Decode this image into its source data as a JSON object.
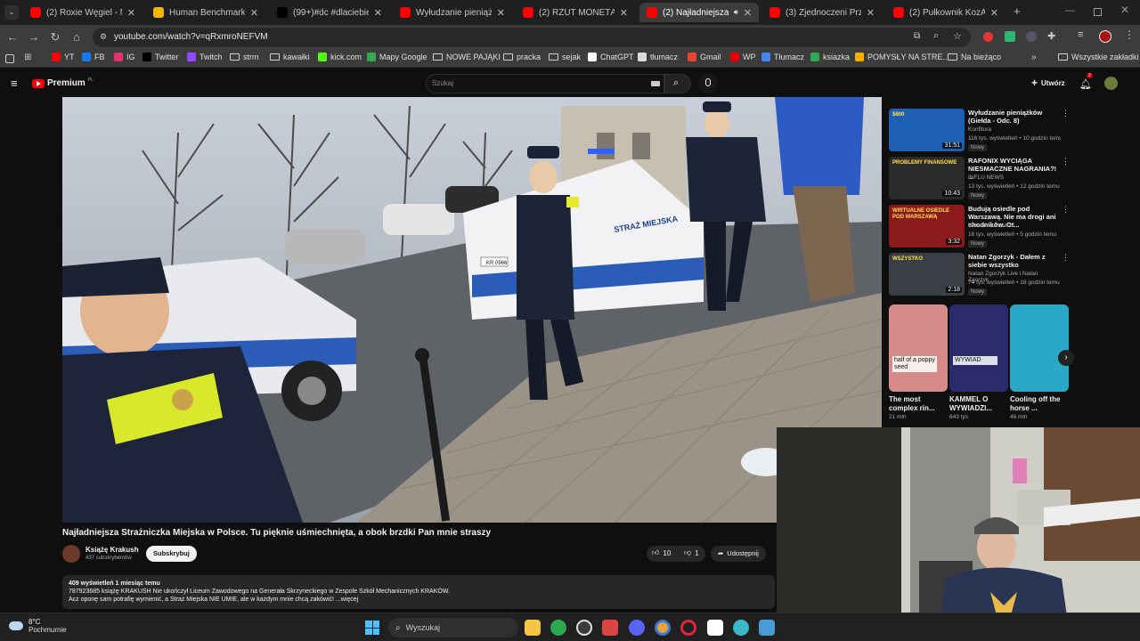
{
  "tabs": [
    {
      "title": "(2) Roxie Węgiel - Miasto",
      "color": "#ff0000"
    },
    {
      "title": "Human Benchmark - Rea",
      "color": "#f5b400"
    },
    {
      "title": "(99+)#dc #dlaciebie #tikt",
      "color": "#000000"
    },
    {
      "title": "Wyłudzanie pieniążków (",
      "color": "#ff0000"
    },
    {
      "title": "(2) RZUT MONETĄ DECYD",
      "color": "#ff0000"
    },
    {
      "title": "(2) Najładniejsza Straż",
      "color": "#ff0000"
    },
    {
      "title": "(3) Zjednoczeni Przeciw R",
      "color": "#ff0000"
    },
    {
      "title": "(2) Pułkownik KozAK z ofi",
      "color": "#ff0000"
    }
  ],
  "address": {
    "url": "youtube.com/watch?v=qRxmroNEFVM"
  },
  "bookmarks": [
    {
      "label": "YT",
      "icon": "youtube-icon",
      "color": "#ff0000"
    },
    {
      "label": "FB",
      "icon": "facebook-icon",
      "color": "#1877f2"
    },
    {
      "label": "IG",
      "icon": "instagram-icon",
      "color": "#e1306c"
    },
    {
      "label": "Twitter",
      "icon": "x-icon",
      "color": "#000000"
    },
    {
      "label": "Twitch",
      "icon": "twitch-icon",
      "color": "#9146ff"
    },
    {
      "label": "strm",
      "icon": "folder-icon"
    },
    {
      "label": "kawałki",
      "icon": "folder-icon"
    },
    {
      "label": "kick.com",
      "icon": "kick-icon",
      "color": "#53fc18"
    },
    {
      "label": "Mapy Google",
      "icon": "map-pin-icon",
      "color": "#34a853"
    },
    {
      "label": "NOWE PAJĄKI",
      "icon": "folder-icon"
    },
    {
      "label": "pracka",
      "icon": "folder-icon"
    },
    {
      "label": "sejak",
      "icon": "folder-icon"
    },
    {
      "label": "ChatGPT",
      "icon": "chatgpt-icon",
      "color": "#ffffff"
    },
    {
      "label": "tłumacz",
      "icon": "translate-icon",
      "color": "#dddddd"
    },
    {
      "label": "Gmail",
      "icon": "gmail-icon",
      "color": "#ea4335"
    },
    {
      "label": "WP",
      "icon": "wp-icon",
      "color": "#e60000"
    },
    {
      "label": "Tłumacz",
      "icon": "google-translate-icon",
      "color": "#4285f4"
    },
    {
      "label": "ksiazka",
      "icon": "grid-icon",
      "color": "#34a853"
    },
    {
      "label": "POMYSŁY NA STRE...",
      "icon": "keep-icon",
      "color": "#f9ab00"
    },
    {
      "label": "Na bieżąco",
      "icon": "folder-icon"
    }
  ],
  "bookmarks_other": "Wszystkie zakładki",
  "yt": {
    "logo_label": "Premium",
    "logo_sup": "PL",
    "search_placeholder": "Szukaj",
    "create_label": "Utwórz",
    "notif_count": "2"
  },
  "video": {
    "title": "Najładniejsza Strażniczka Miejska w Polsce. Tu pięknie uśmiechnięta, a obok brzdki Pan mnie straszy",
    "channel": "Książę Krakush",
    "subs": "437 subskrybentów",
    "subscribe_label": "Subskrybuj",
    "likes": "10",
    "dislikes": "1",
    "share_label": "Udostępnij",
    "desc_line1": "409 wyświetleń  1 miesiąc temu",
    "desc_line2": "787923685 książę KRAKUSH Nie ukończył Liceum Zawodowego na Generała Skrzyneckiego w Zespole Szkół Mechanicznych KRAKÓW.",
    "desc_line3": "Acz oponę sam potrafię wymienić, a Straż Miejska NIE UMIE, ale w każdym mnie chcą zakówić! ...więcej",
    "car_text": "STRAŻ MIEJSKA",
    "plate": "KR 0966"
  },
  "recommendations": [
    {
      "title": "Wyłudzanie pieniążków (Giełda - Odc. 8)",
      "channel": "Konfitura",
      "meta": "116 tys. wyświetleń • 10 godzin temu",
      "badge": "Nowy",
      "duration": "31:51",
      "thumb": "#1d5fb3",
      "thumb_text": "$800"
    },
    {
      "title": "RAFONIX WYCIĄGA NIESMACZNE NAGRANIA?! ...",
      "channel": "INFLU NEWS",
      "meta": "13 tys. wyświetleń • 12 godzin temu",
      "badge": "Nowy",
      "duration": "10:43",
      "thumb": "#2a2a2a",
      "thumb_text": "PROBLEMY FINANSOWE"
    },
    {
      "title": "Budują osiedle pod Warszawą. Nie ma drogi ani chodników. Ot...",
      "channel": "Wirtualna Polska",
      "meta": "16 tys. wyświetleń • 5 godzin temu",
      "badge": "Nowy",
      "duration": "3:32",
      "thumb": "#8b1a1a",
      "thumb_text": "WIRTUALNE OSIEDLE POD WARSZAWĄ"
    },
    {
      "title": "Natan Zgorzyk - Dałem z siebie wszystko",
      "channel": "Natan Zgorzyk Live i Natan Zgorzyk",
      "meta": "74 tys. wyświetleń • 18 godzin temu",
      "badge": "Nowy",
      "duration": "2:18",
      "thumb": "#3a3f45",
      "thumb_text": "WSZYSTKO"
    }
  ],
  "shorts": [
    {
      "title": "The most complex rin...",
      "meta": "21 mln",
      "thumb_text": "half of a poppy seed",
      "thumb": "#d68a8a"
    },
    {
      "title": "KAMMEL O WYWIADZI...",
      "meta": "643 tys.",
      "thumb_text": "WYWIAD",
      "thumb": "#2b2b6b"
    },
    {
      "title": "Cooling off the horse ...",
      "meta": "46 mln",
      "thumb_text": "",
      "thumb": "#2aa8c7"
    }
  ],
  "taskbar": {
    "weather_temp": "8°C",
    "weather_desc": "Pochmurnie",
    "search_label": "Wyszukaj"
  },
  "colors": {
    "accent": "#ff0000",
    "bg": "#0f0f0f"
  }
}
